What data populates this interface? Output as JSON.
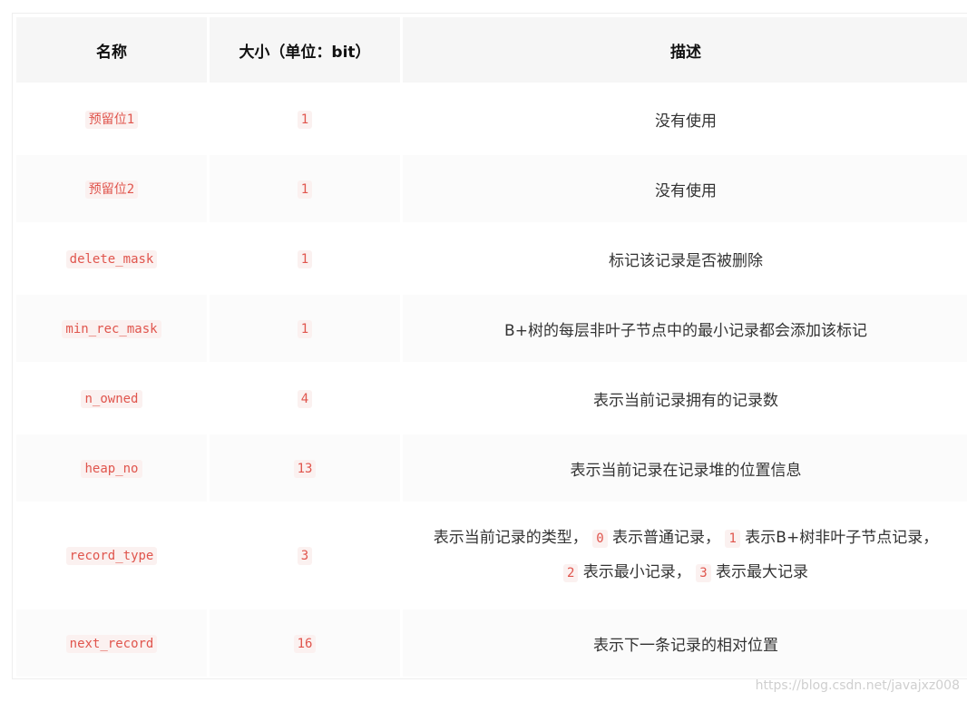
{
  "table": {
    "headers": [
      "名称",
      "大小（单位：bit）",
      "描述"
    ],
    "rows": [
      {
        "name": "预留位1",
        "size": "1",
        "desc": "没有使用"
      },
      {
        "name": "预留位2",
        "size": "1",
        "desc": "没有使用"
      },
      {
        "name": "delete_mask",
        "size": "1",
        "desc": "标记该记录是否被删除"
      },
      {
        "name": "min_rec_mask",
        "size": "1",
        "desc": "B+树的每层非叶子节点中的最小记录都会添加该标记"
      },
      {
        "name": "n_owned",
        "size": "4",
        "desc": "表示当前记录拥有的记录数"
      },
      {
        "name": "heap_no",
        "size": "13",
        "desc": "表示当前记录在记录堆的位置信息"
      },
      {
        "name": "record_type",
        "size": "3",
        "desc_parts": [
          "表示当前记录的类型，",
          "0",
          "表示普通记录，",
          "1",
          "表示B+树非叶子节点记录，",
          "2",
          "表示最小记录，",
          "3",
          "表示最大记录"
        ]
      },
      {
        "name": "next_record",
        "size": "16",
        "desc": "表示下一条记录的相对位置"
      }
    ]
  },
  "watermark": "https://blog.csdn.net/javajxz008"
}
